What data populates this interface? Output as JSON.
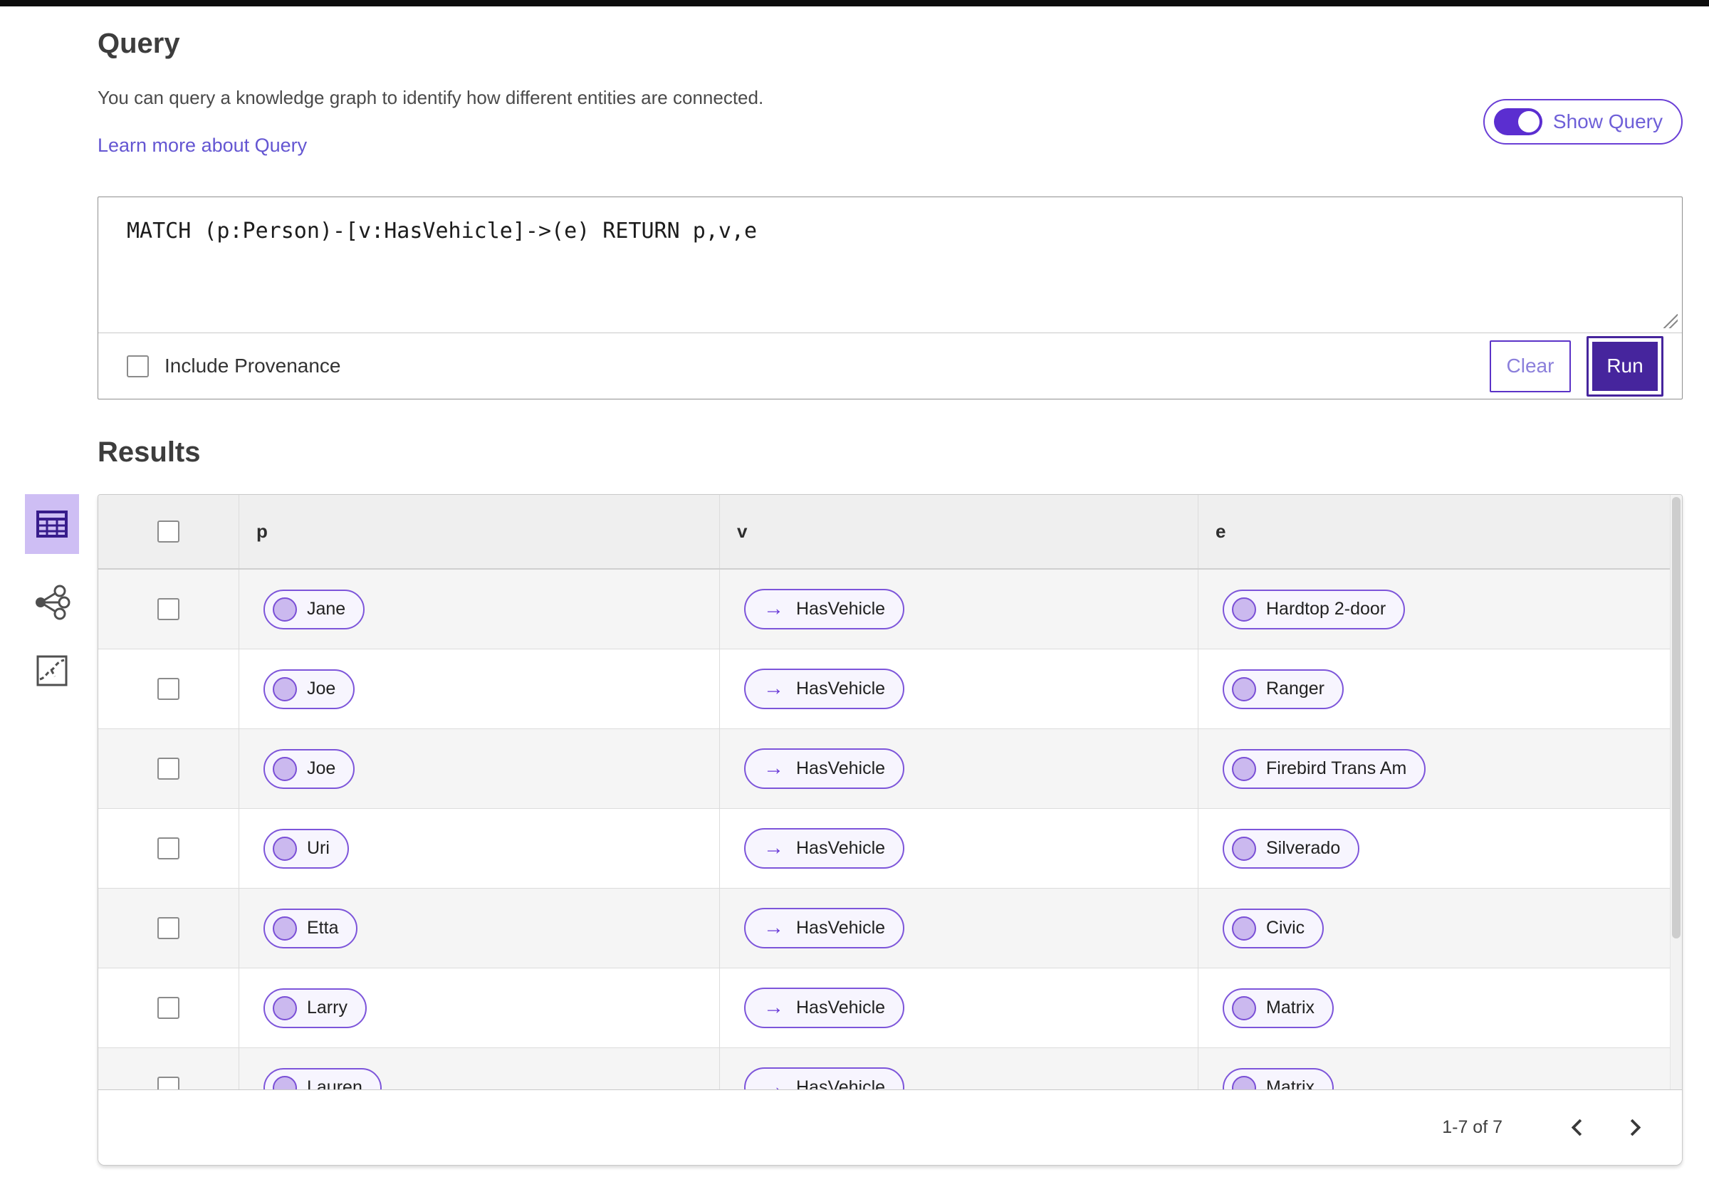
{
  "query_section": {
    "title": "Query",
    "description": "You can query a knowledge graph to identify how different entities are connected.",
    "learn_more_link": "Learn more about Query",
    "show_query_toggle": {
      "label": "Show Query",
      "state_on": true
    },
    "editor": {
      "query_text": "MATCH (p:Person)-[v:HasVehicle]->(e) RETURN p,v,e"
    },
    "include_provenance": {
      "label": "Include Provenance",
      "checked": false
    },
    "buttons": {
      "clear": "Clear",
      "run": "Run"
    }
  },
  "results_section": {
    "title": "Results",
    "views": [
      {
        "name": "table-view",
        "selected": true
      },
      {
        "name": "graph-view",
        "selected": false
      },
      {
        "name": "map-view",
        "selected": false
      }
    ],
    "table": {
      "columns": [
        "p",
        "v",
        "e"
      ],
      "rows": [
        {
          "p": "Jane",
          "v": "HasVehicle",
          "e": "Hardtop 2-door"
        },
        {
          "p": "Joe",
          "v": "HasVehicle",
          "e": "Ranger"
        },
        {
          "p": "Joe",
          "v": "HasVehicle",
          "e": "Firebird Trans Am"
        },
        {
          "p": "Uri",
          "v": "HasVehicle",
          "e": "Silverado"
        },
        {
          "p": "Etta",
          "v": "HasVehicle",
          "e": "Civic"
        },
        {
          "p": "Larry",
          "v": "HasVehicle",
          "e": "Matrix"
        },
        {
          "p": "Lauren",
          "v": "HasVehicle",
          "e": "Matrix"
        }
      ]
    },
    "pagination": {
      "range_label": "1-7 of 7",
      "prev_icon": "chevron-left",
      "next_icon": "chevron-right"
    }
  },
  "icons": {
    "arrow_right": "→"
  },
  "colors": {
    "accent_purple": "#5B2ED0",
    "deep_purple_run": "#46259D",
    "link_purple": "#6456D2",
    "pill_border": "#7D55DA",
    "pill_background": "#F7F5FE",
    "node_circle_fill": "#CBB9EF",
    "selected_view_background": "#CEBEF4",
    "table_header_background": "#EFEFEF",
    "row_stripe_background": "#F5F5F5",
    "top_bar": "#0C0C0C"
  }
}
